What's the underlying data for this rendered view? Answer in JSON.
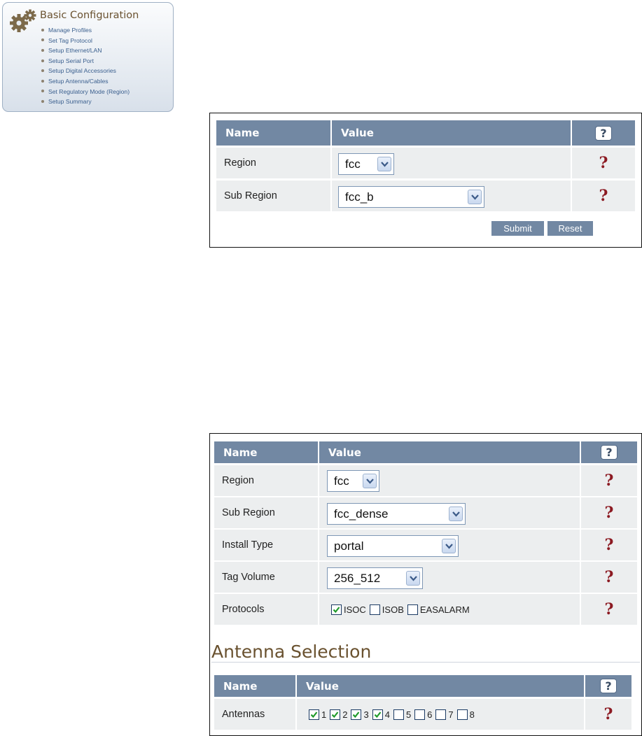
{
  "menu": {
    "title": "Basic Configuration",
    "items": [
      "Manage Profiles",
      "Set Tag Protocol",
      "Setup Ethernet/LAN",
      "Setup Serial Port",
      "Setup Digital Accessories",
      "Setup Antenna/Cables",
      "Set Regulatory Mode (Region)",
      "Setup Summary"
    ]
  },
  "panel1": {
    "header": {
      "name": "Name",
      "value": "Value",
      "help": "?"
    },
    "rows": [
      {
        "label": "Region",
        "value": "fcc",
        "help": "?"
      },
      {
        "label": "Sub Region",
        "value": "fcc_b",
        "help": "?"
      }
    ],
    "buttons": {
      "submit": "Submit",
      "reset": "Reset"
    }
  },
  "panel2": {
    "header": {
      "name": "Name",
      "value": "Value",
      "help": "?"
    },
    "rows": [
      {
        "label": "Region",
        "value": "fcc",
        "help": "?"
      },
      {
        "label": "Sub Region",
        "value": "fcc_dense",
        "help": "?"
      },
      {
        "label": "Install Type",
        "value": "portal",
        "help": "?"
      },
      {
        "label": "Tag Volume",
        "value": "256_512",
        "help": "?"
      },
      {
        "label": "Protocols",
        "help": "?"
      }
    ],
    "protocols": [
      {
        "label": "ISOC",
        "checked": true
      },
      {
        "label": "ISOB",
        "checked": false
      },
      {
        "label": "EASALARM",
        "checked": false
      }
    ],
    "antenna_section": {
      "title": "Antenna Selection",
      "header": {
        "name": "Name",
        "value": "Value",
        "help": "?"
      },
      "row_label": "Antennas",
      "help": "?",
      "antennas": [
        {
          "label": "1",
          "checked": true
        },
        {
          "label": "2",
          "checked": true
        },
        {
          "label": "3",
          "checked": true
        },
        {
          "label": "4",
          "checked": true
        },
        {
          "label": "5",
          "checked": false
        },
        {
          "label": "6",
          "checked": false
        },
        {
          "label": "7",
          "checked": false
        },
        {
          "label": "8",
          "checked": false
        }
      ]
    }
  },
  "colors": {
    "header_bg": "#7288a3",
    "row_bg": "#eceeef",
    "help_mark": "#8c1a22",
    "section_title": "#6a5230",
    "menu_link": "#3a5f8e"
  }
}
